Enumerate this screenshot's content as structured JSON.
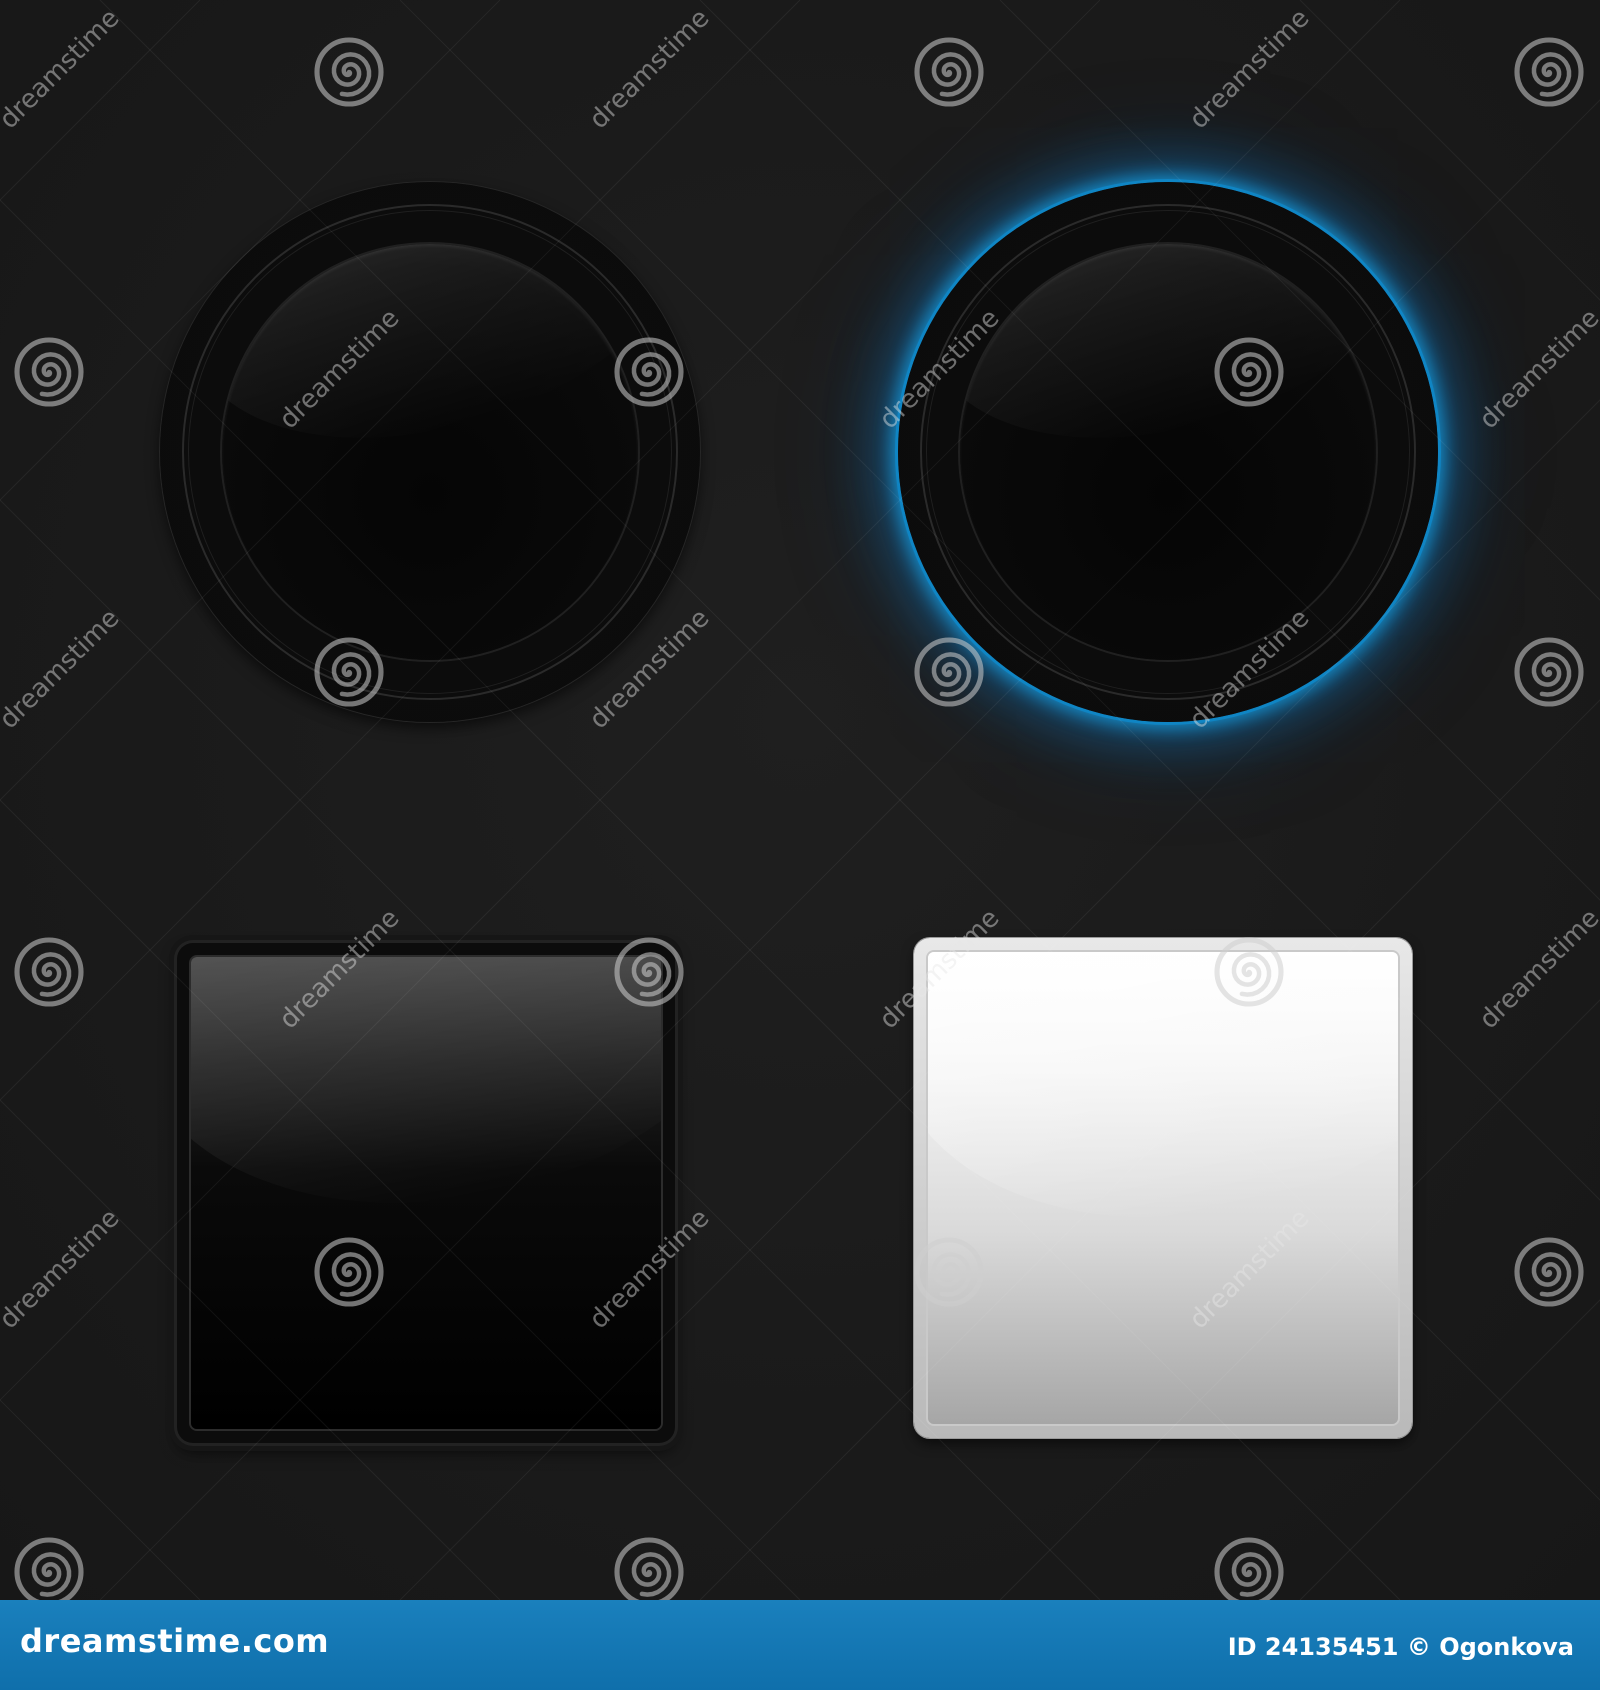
{
  "watermark": {
    "brand": "dreamstime",
    "logo_icon": "dreamstime-spiral-icon"
  },
  "buttons": [
    {
      "shape": "round",
      "state": "off",
      "glow": false
    },
    {
      "shape": "round",
      "state": "on",
      "glow": true,
      "glow_color": "#169ee1"
    },
    {
      "shape": "square",
      "color": "black"
    },
    {
      "shape": "square",
      "color": "white"
    }
  ],
  "footer": {
    "site": "dreamstime.com",
    "credit": "ID 24135451 © Ogonkova",
    "bar_color": "#1474b4"
  },
  "colors": {
    "background": "#1a1a1a",
    "glow": "#169ee1",
    "footer": "#1474b4"
  }
}
